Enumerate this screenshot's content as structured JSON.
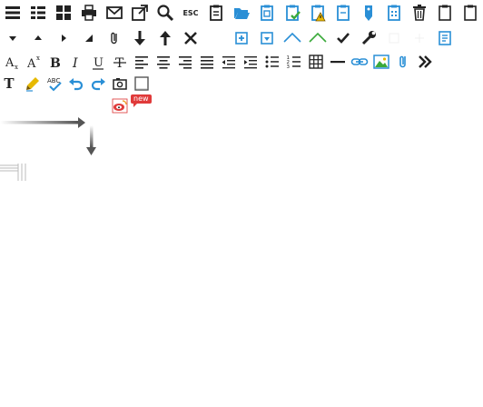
{
  "toolbar": {
    "esc_label": "ESC",
    "new_badge": "new",
    "text_tool_glyph": "T",
    "colors": {
      "icon": "#222222",
      "blue": "#2a8fd6",
      "green": "#3aaa3a",
      "yellow": "#e7b900",
      "red": "#e03a3a",
      "gray": "#7a7a7a"
    }
  }
}
